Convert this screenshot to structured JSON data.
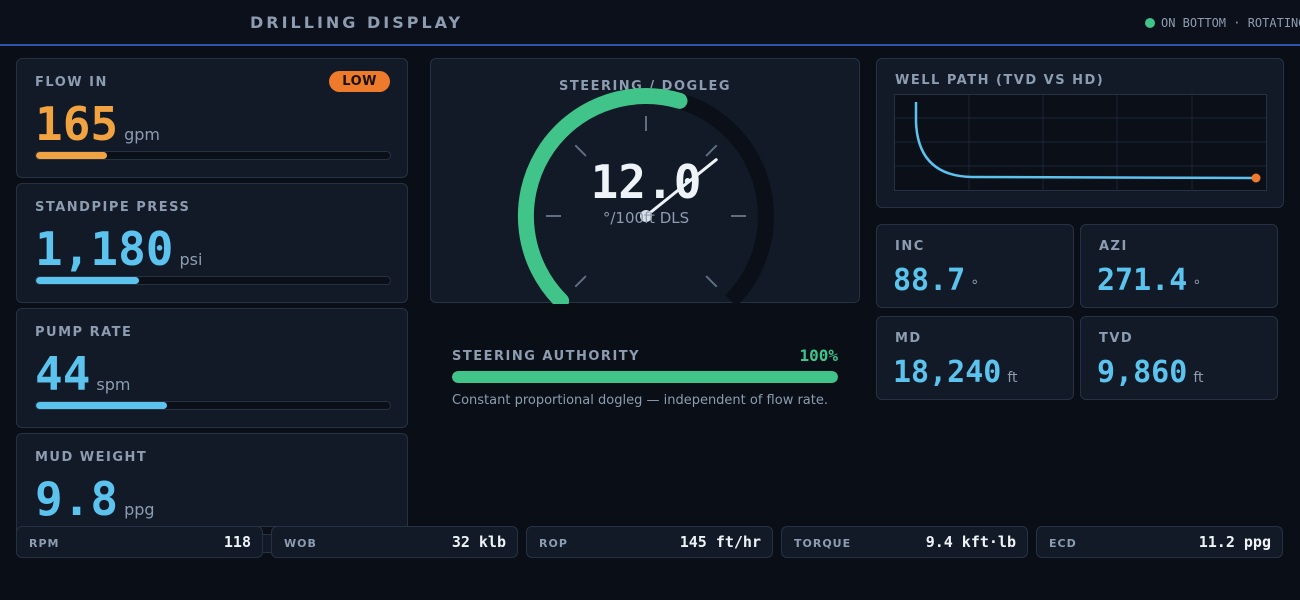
{
  "header": {
    "title": "DRILLING DISPLAY",
    "status_text": "ON BOTTOM · ROTATING",
    "status_color": "#41c48a"
  },
  "metrics": [
    {
      "label": "FLOW IN",
      "value": "165",
      "unit": "gpm",
      "bar_fraction": 0.2,
      "color": "#f0a340",
      "badge": "LOW"
    },
    {
      "label": "STANDPIPE PRESS",
      "value": "1,180",
      "unit": "psi",
      "bar_fraction": 0.29,
      "color": "#5bc3ee"
    },
    {
      "label": "PUMP RATE",
      "value": "44",
      "unit": "spm",
      "bar_fraction": 0.37,
      "color": "#5bc3ee"
    },
    {
      "label": "MUD WEIGHT",
      "value": "9.8",
      "unit": "ppg",
      "bar_fraction": 0.6,
      "color": "#5bc3ee"
    }
  ],
  "gauge": {
    "title": "STEERING / DOGLEG",
    "value": "12.0",
    "unit": "°/100ft DLS",
    "fill_fraction": 0.56,
    "needle_fraction": 0.69
  },
  "steering_authority": {
    "label": "STEERING AUTHORITY",
    "percent_text": "100%",
    "fraction": 1.0,
    "note": "Constant proportional dogleg — independent of flow rate."
  },
  "well_path": {
    "title": "WELL PATH (TVD vs HD)",
    "line_color": "#5bc3ee",
    "marker_color": "#ee7a2c"
  },
  "nav": [
    {
      "label": "INC",
      "value": "88.7",
      "unit": "°"
    },
    {
      "label": "AZI",
      "value": "271.4",
      "unit": "°"
    },
    {
      "label": "MD",
      "value": "18,240",
      "unit": "ft"
    },
    {
      "label": "TVD",
      "value": "9,860",
      "unit": "ft"
    }
  ],
  "strip": [
    {
      "label": "RPM",
      "value": "118"
    },
    {
      "label": "WOB",
      "value": "32 klb"
    },
    {
      "label": "ROP",
      "value": "145 ft/hr"
    },
    {
      "label": "TORQUE",
      "value": "9.4 kft·lb"
    },
    {
      "label": "ECD",
      "value": "11.2 ppg"
    }
  ]
}
